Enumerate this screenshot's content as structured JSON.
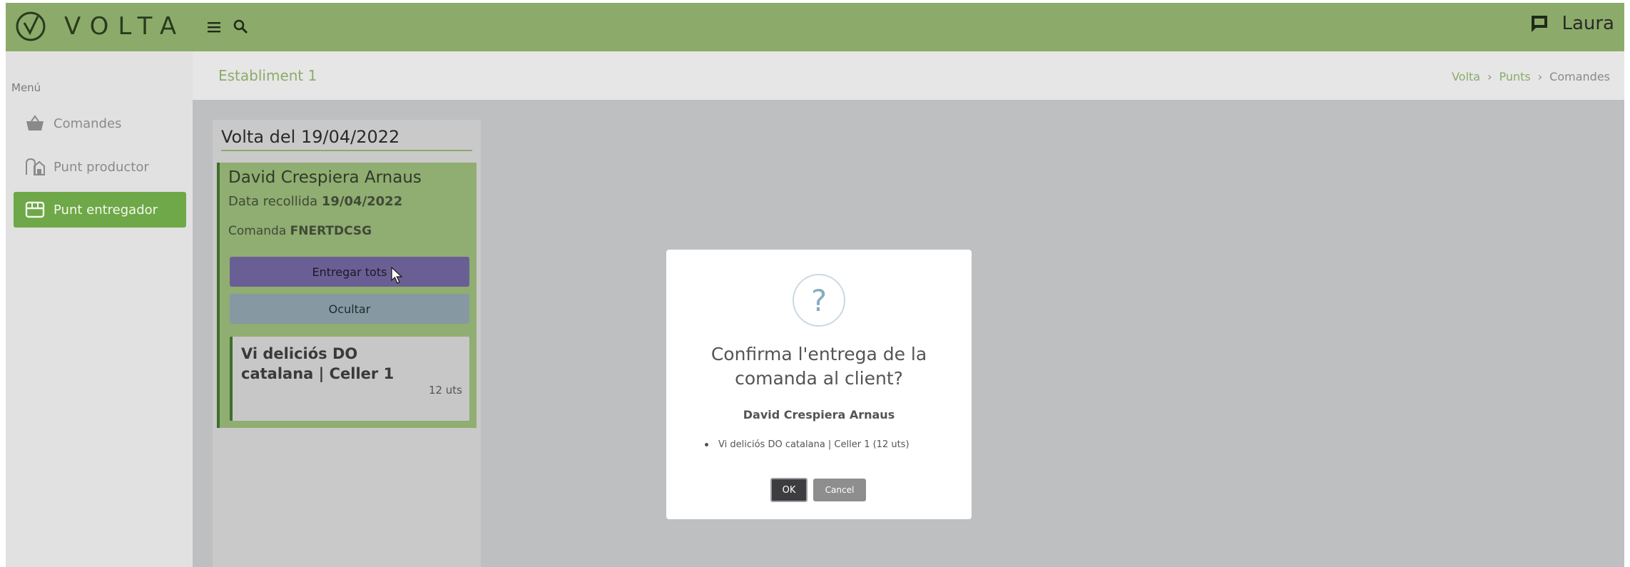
{
  "header": {
    "brand": "VOLTA",
    "user_name": "Laura",
    "icons": [
      "volta-logo-icon",
      "menu-icon",
      "search-icon",
      "chat-icon"
    ],
    "bg_color": "#8cab6a"
  },
  "sidebar": {
    "menu_label": "Menú",
    "items": [
      {
        "label": "Comandes",
        "icon": "basket-icon",
        "active": false
      },
      {
        "label": "Punt productor",
        "icon": "farm-icon",
        "active": false
      },
      {
        "label": "Punt entregador",
        "icon": "store-icon",
        "active": true
      }
    ],
    "active_color": "#6ea848"
  },
  "page": {
    "title": "Establiment 1",
    "breadcrumb": [
      "Volta",
      "Punts",
      "Comandes"
    ]
  },
  "volta": {
    "title": "Volta del 19/04/2022",
    "order": {
      "client": "David Crespiera Arnaus",
      "date_label": "Data recollida",
      "date_value": "19/04/2022",
      "order_label": "Comanda",
      "order_code": "FNERTDCSG",
      "deliver_all_label": "Entregar tots",
      "hide_label": "Ocultar",
      "product": {
        "name": "Vi deliciós DO catalana | Celler 1",
        "quantity": "12 uts"
      }
    }
  },
  "modal": {
    "icon": "question-icon",
    "title": "Confirma l'entrega de la comanda al client?",
    "client": "David Crespiera Arnaus",
    "items": [
      "Vi deliciós DO catalana | Celler 1 (12 uts)"
    ],
    "ok_label": "OK",
    "cancel_label": "Cancel"
  }
}
